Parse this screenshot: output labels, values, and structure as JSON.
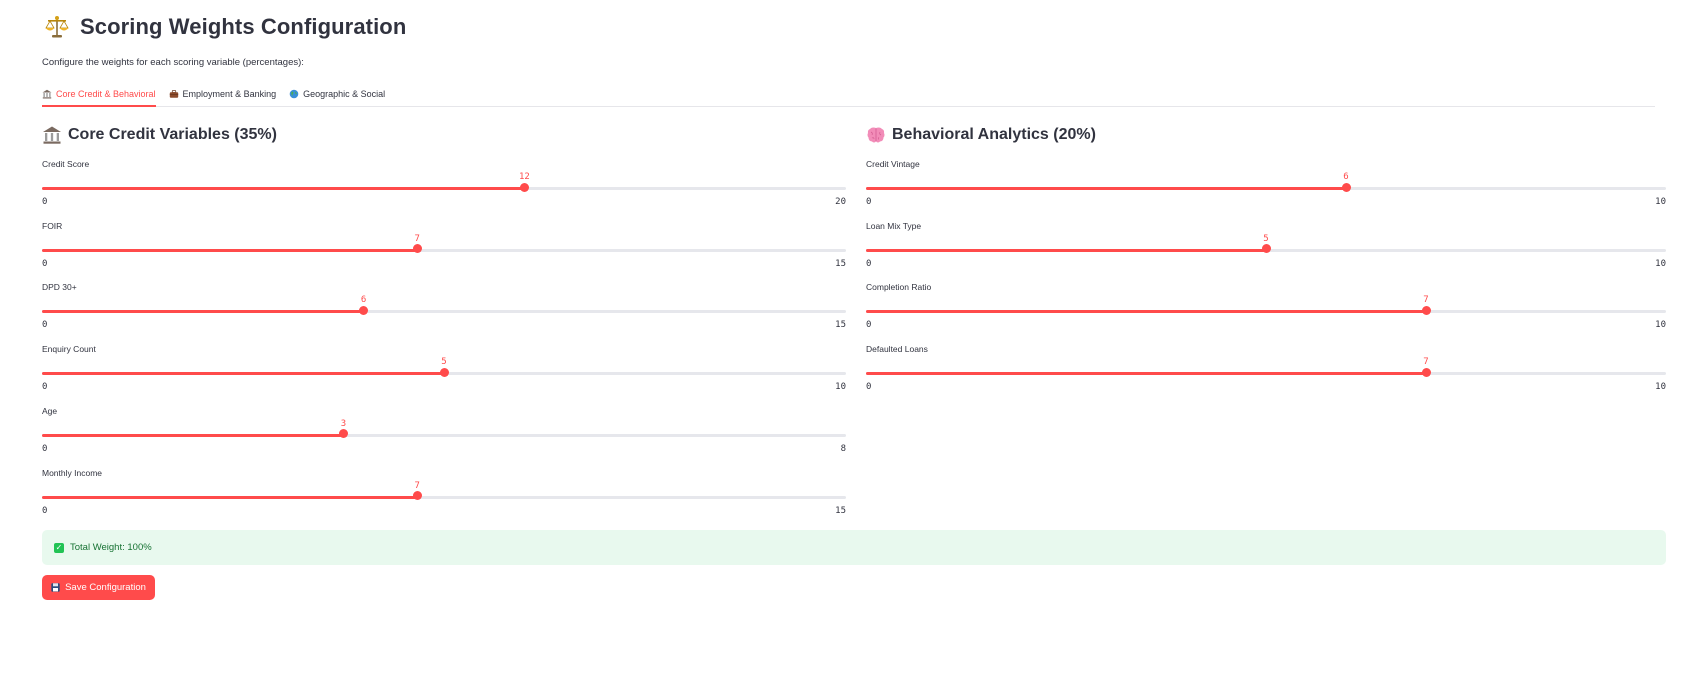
{
  "page": {
    "title": "Scoring Weights Configuration",
    "title_icon": "balance-scale-icon",
    "subtitle": "Configure the weights for each scoring variable (percentages):"
  },
  "tabs": [
    {
      "label": "Core Credit & Behavioral",
      "icon": "bank-icon",
      "active": true
    },
    {
      "label": "Employment & Banking",
      "icon": "briefcase-icon",
      "active": false
    },
    {
      "label": "Geographic & Social",
      "icon": "globe-icon",
      "active": false
    }
  ],
  "left_section": {
    "title": "Core Credit Variables (35%)",
    "icon": "bank-icon",
    "sliders": [
      {
        "label": "Credit Score",
        "value": "12",
        "min": "0",
        "max": "20"
      },
      {
        "label": "FOIR",
        "value": "7",
        "min": "0",
        "max": "15"
      },
      {
        "label": "DPD 30+",
        "value": "6",
        "min": "0",
        "max": "15"
      },
      {
        "label": "Enquiry Count",
        "value": "5",
        "min": "0",
        "max": "10"
      },
      {
        "label": "Age",
        "value": "3",
        "min": "0",
        "max": "8"
      },
      {
        "label": "Monthly Income",
        "value": "7",
        "min": "0",
        "max": "15"
      }
    ]
  },
  "right_section": {
    "title": "Behavioral Analytics (20%)",
    "icon": "brain-icon",
    "sliders": [
      {
        "label": "Credit Vintage",
        "value": "6",
        "min": "0",
        "max": "10"
      },
      {
        "label": "Loan Mix Type",
        "value": "5",
        "min": "0",
        "max": "10"
      },
      {
        "label": "Completion Ratio",
        "value": "7",
        "min": "0",
        "max": "10"
      },
      {
        "label": "Defaulted Loans",
        "value": "7",
        "min": "0",
        "max": "10"
      }
    ]
  },
  "status": {
    "icon": "check-box-icon",
    "text": "Total Weight: 100%"
  },
  "save_button": {
    "label": "Save Configuration",
    "icon": "floppy-disk-icon"
  },
  "colors": {
    "accent": "#ff4b4b",
    "track": "#e6e7ec",
    "success_bg": "#e8f9ee",
    "success_text": "#177233",
    "text": "#31333f"
  }
}
